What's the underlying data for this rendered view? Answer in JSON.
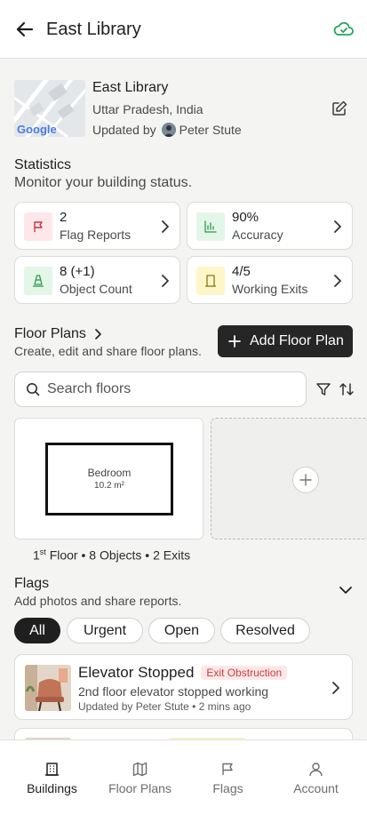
{
  "header": {
    "title": "East Library",
    "back_icon": "arrow-left-icon",
    "sync_icon": "cloud-check-icon",
    "sync_color": "#22a55b"
  },
  "building": {
    "name": "East Library",
    "location": "Uttar Pradesh, India",
    "updated_prefix": "Updated by",
    "updated_by": "Peter Stute",
    "map_logo": "Google",
    "edit_icon": "edit-icon"
  },
  "statistics": {
    "title": "Statistics",
    "subtitle": "Monitor your building status.",
    "cards": [
      {
        "value": "2",
        "label": "Flag Reports",
        "icon": "flag-icon",
        "color": "#fde7ea"
      },
      {
        "value": "90%",
        "label": "Accuracy",
        "icon": "bar-chart-icon",
        "color": "#e4f6e8"
      },
      {
        "value": "8 (+1)",
        "label": "Object Count",
        "icon": "cone-icon",
        "color": "#e4f6e8"
      },
      {
        "value": "4/5",
        "label": "Working Exits",
        "icon": "exit-door-icon",
        "color": "#fdf6c9"
      }
    ]
  },
  "floor_plans": {
    "title": "Floor Plans",
    "subtitle": "Create, edit and share floor plans.",
    "add_button": "Add Floor Plan",
    "search_placeholder": "Search floors",
    "plan": {
      "room_name": "Bedroom",
      "room_area": "10.2 m²",
      "floor_number": "1",
      "floor_suffix": "st",
      "caption_rest": " Floor • 8 Objects • 2 Exits"
    }
  },
  "flags": {
    "title": "Flags",
    "subtitle": "Add photos and share reports.",
    "filters": [
      "All",
      "Urgent",
      "Open",
      "Resolved"
    ],
    "active_filter": "All",
    "items": [
      {
        "title": "Elevator Stopped",
        "badge": "Exit Obstruction",
        "badge_color": "#d23b3b",
        "description": "2nd floor elevator stopped working",
        "meta": "Updated by Peter Stute • 2 mins ago"
      }
    ]
  },
  "bottom_nav": {
    "items": [
      {
        "label": "Buildings",
        "icon": "building-icon",
        "active": true
      },
      {
        "label": "Floor Plans",
        "icon": "map-icon",
        "active": false
      },
      {
        "label": "Flags",
        "icon": "flag-icon",
        "active": false
      },
      {
        "label": "Account",
        "icon": "user-icon",
        "active": false
      }
    ]
  }
}
